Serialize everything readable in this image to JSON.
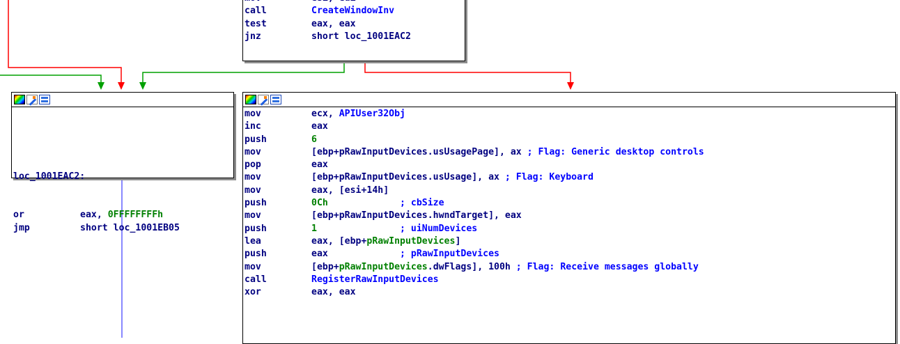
{
  "top_block": {
    "lines": [
      {
        "mnemonic": "mov",
        "operands": [
          {
            "text": "esi, edi",
            "kind": "op"
          }
        ]
      },
      {
        "mnemonic": "call",
        "operands": [
          {
            "text": "CreateWindowInv",
            "kind": "sym"
          }
        ]
      },
      {
        "mnemonic": "test",
        "operands": [
          {
            "text": "eax, eax",
            "kind": "op"
          }
        ]
      },
      {
        "mnemonic": "jnz",
        "operands": [
          {
            "text": "short loc_1001EAC2",
            "kind": "op"
          }
        ]
      }
    ]
  },
  "left_block": {
    "label": "loc_1001EAC2:",
    "lines": [
      {
        "mnemonic": "or",
        "operands": [
          {
            "text": "eax, ",
            "kind": "op"
          },
          {
            "text": "0FFFFFFFFh",
            "kind": "num"
          }
        ]
      },
      {
        "mnemonic": "jmp",
        "operands": [
          {
            "text": "short loc_1001EB05",
            "kind": "op"
          }
        ]
      }
    ]
  },
  "right_block": {
    "lines": [
      {
        "mnemonic": "mov",
        "operands": [
          {
            "text": "ecx, ",
            "kind": "op"
          },
          {
            "text": "APIUser32Obj",
            "kind": "sym"
          }
        ]
      },
      {
        "mnemonic": "inc",
        "operands": [
          {
            "text": "eax",
            "kind": "op"
          }
        ]
      },
      {
        "mnemonic": "push",
        "operands": [
          {
            "text": "6",
            "kind": "num"
          }
        ]
      },
      {
        "mnemonic": "mov",
        "operands": [
          {
            "text": "[ebp+pRawInputDevices.usUsagePage], ax ",
            "kind": "op"
          },
          {
            "text": "; Flag: Generic desktop controls",
            "kind": "cmt"
          }
        ]
      },
      {
        "mnemonic": "pop",
        "operands": [
          {
            "text": "eax",
            "kind": "op"
          }
        ]
      },
      {
        "mnemonic": "mov",
        "operands": [
          {
            "text": "[ebp+pRawInputDevices.usUsage], ax ",
            "kind": "op"
          },
          {
            "text": "; Flag: Keyboard",
            "kind": "cmt"
          }
        ]
      },
      {
        "mnemonic": "mov",
        "operands": [
          {
            "text": "eax, [esi+14h]",
            "kind": "op"
          }
        ]
      },
      {
        "mnemonic": "push",
        "operands": [
          {
            "text": "0Ch",
            "kind": "num"
          },
          {
            "text": "             ; cbSize",
            "kind": "cmt"
          }
        ]
      },
      {
        "mnemonic": "mov",
        "operands": [
          {
            "text": "[ebp+pRawInputDevices.hwndTarget], eax",
            "kind": "op"
          }
        ]
      },
      {
        "mnemonic": "push",
        "operands": [
          {
            "text": "1",
            "kind": "num"
          },
          {
            "text": "               ; uiNumDevices",
            "kind": "cmt"
          }
        ]
      },
      {
        "mnemonic": "lea",
        "operands": [
          {
            "text": "eax, [ebp+",
            "kind": "op"
          },
          {
            "text": "pRawInputDevices",
            "kind": "num"
          },
          {
            "text": "]",
            "kind": "op"
          }
        ]
      },
      {
        "mnemonic": "push",
        "operands": [
          {
            "text": "eax",
            "kind": "op"
          },
          {
            "text": "             ; pRawInputDevices",
            "kind": "cmt"
          }
        ]
      },
      {
        "mnemonic": "mov",
        "operands": [
          {
            "text": "[ebp+",
            "kind": "op"
          },
          {
            "text": "pRawInputDevices",
            "kind": "num"
          },
          {
            "text": ".dwFlags], 100h ",
            "kind": "op"
          },
          {
            "text": "; Flag: Receive messages globally",
            "kind": "cmt"
          }
        ]
      },
      {
        "mnemonic": "call",
        "operands": [
          {
            "text": "RegisterRawInputDevices",
            "kind": "sym"
          }
        ]
      },
      {
        "mnemonic": "xor",
        "operands": [
          {
            "text": "eax, eax",
            "kind": "op"
          }
        ]
      }
    ]
  },
  "colors": {
    "true_edge": "#00a000",
    "false_edge": "#ff0000",
    "uncond_edge": "#6060ff",
    "mnemonic": "#000080",
    "number": "#008000",
    "symbol": "#0000ff",
    "comment": "#0000ff"
  },
  "icons": [
    "color-palette-icon",
    "edit-comment-icon",
    "graph-view-icon"
  ]
}
